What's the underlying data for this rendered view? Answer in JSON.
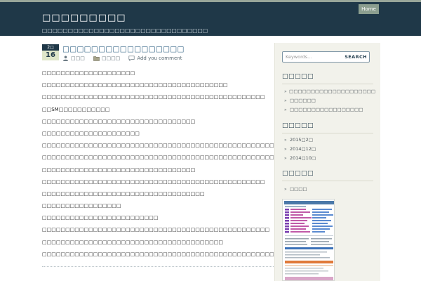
{
  "header": {
    "site_title": "□□□□□□□□□",
    "site_description": "□□□□□□□□□□□□□□□□□□□□□□□□□□□□□□□□",
    "nav_home": "Home"
  },
  "post": {
    "date_month": "2□",
    "date_day": "16",
    "title": "□□□□□□□□□□□□□□□□□",
    "author": "□□□",
    "category": "□□□□",
    "comment_link": "Add you comment",
    "lines": [
      "□□□□□□□□□□□□□□□□□□□□",
      "□□□□□□□□□□□□□□□□□□□□□□□□□□□□□□□□□□□□□□□□",
      "□□□□□□□□□□□□□□□□□□□□□□□□□□□□□□□□□□□□□□□□□□□□□□□□",
      "□□SM□□□□□□□□□□□",
      "□□□□□□□□□□□□□□□□□□□□□□□□□□□□□□□□□",
      "□□□□□□□□□□□□□□□□□□□□□",
      "□□□□□□□□□□□□□□□□□□□□□□□□□□□□□□□□□□□□□□□□□□□□□□□□□□",
      "□□□□□□□□□□□□□□□□□□□□□□□□□□□□□□□□□□□□□□□□□□□□□□□□□□□□□□□□□□□□□",
      "□□□□□□□□□□□□□□□□□□□□□□□□□□□□□□□□□",
      "□□□□□□□□□□□□□□□□□□□□□□□□□□□□□□□□□□□□□□□□□□□□□□□□",
      "□□□□□□□□□□□□□□□□□□□□□□□□□□□□□□□□□□□",
      "□□□□□□□□□□□□□□□□□",
      "□□□□□□□□□□□□□□□□□□□□□□□□□",
      "□□□□□□□□□□□□□□□□□□□□□□□□□□□□□□□□□□□□□□□□□□□□□□□□□",
      "□□□□□□□□□□□□□□□□□□□□□□□□□□□□□□□□□□□□□□□",
      "□□□□□□□□□□□□□□□□□□□□□□□□□□□□□□□□□□□□□□□□□□□□□□□□□□□□□□□□□□□□□□□□□□□□□□□□□"
    ]
  },
  "sidebar": {
    "search_placeholder": "Keywords...",
    "search_button": "SEARCH",
    "widgets": [
      {
        "title": "□□□□□",
        "items": [
          "□□□□□□□□□□□□□□□□□□□□",
          "□□□□□□",
          "□□□□□□□□□□□□□□□□□"
        ]
      },
      {
        "title": "□□□□□",
        "items": [
          "2015□2□",
          "2014□12□",
          "2014□10□"
        ]
      },
      {
        "title": "□□□□□",
        "items": [
          "□□□□"
        ]
      }
    ]
  },
  "icons": {
    "author": "user-icon",
    "category": "folder-icon",
    "comment": "comment-icon",
    "bullet": "chevron-right-icon"
  },
  "colors": {
    "header_bg": "#1f3848",
    "nav_active_bg": "#8b9e8f",
    "link": "#2a5d80",
    "sidebar_bg": "#f2f2eb",
    "date_day_bg": "#dfe6c9"
  }
}
